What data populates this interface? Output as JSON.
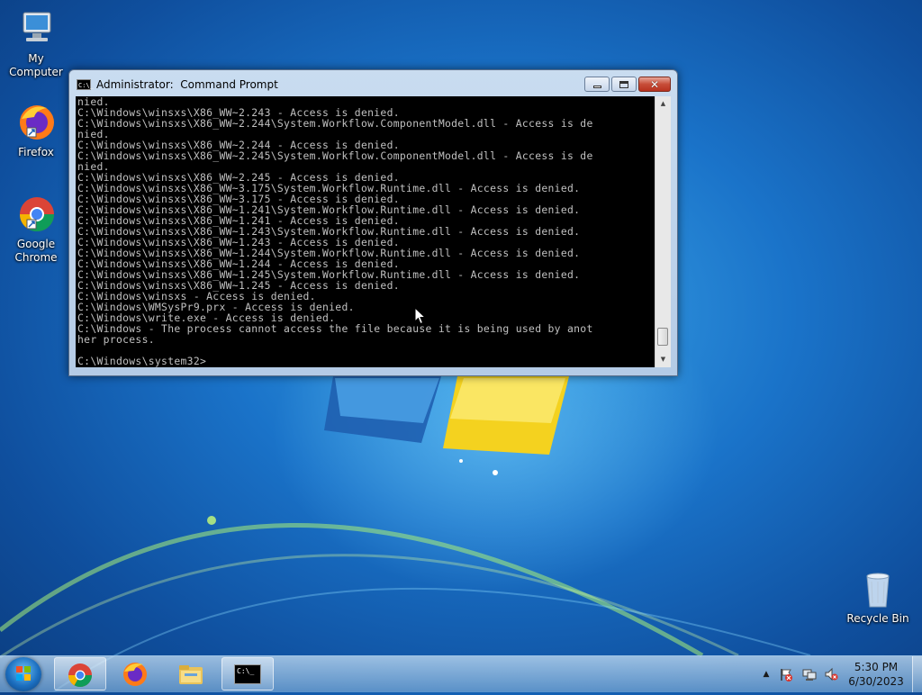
{
  "desktop": {
    "icons": [
      {
        "label": "My Computer"
      },
      {
        "label": "Firefox"
      },
      {
        "label": "Google\nChrome"
      },
      {
        "label": "Recycle Bin"
      }
    ]
  },
  "cmd_window": {
    "title": "Administrator:  Command Prompt",
    "icon_text": "C:\\_",
    "buttons": {
      "minimize": "minimize",
      "maximize": "maximize",
      "close": "✕"
    },
    "lines": [
      "nied.",
      "C:\\Windows\\winsxs\\X86_WW~2.243 - Access is denied.",
      "C:\\Windows\\winsxs\\X86_WW~2.244\\System.Workflow.ComponentModel.dll - Access is de",
      "nied.",
      "C:\\Windows\\winsxs\\X86_WW~2.244 - Access is denied.",
      "C:\\Windows\\winsxs\\X86_WW~2.245\\System.Workflow.ComponentModel.dll - Access is de",
      "nied.",
      "C:\\Windows\\winsxs\\X86_WW~2.245 - Access is denied.",
      "C:\\Windows\\winsxs\\X86_WW~3.175\\System.Workflow.Runtime.dll - Access is denied.",
      "C:\\Windows\\winsxs\\X86_WW~3.175 - Access is denied.",
      "C:\\Windows\\winsxs\\X86_WW~1.241\\System.Workflow.Runtime.dll - Access is denied.",
      "C:\\Windows\\winsxs\\X86_WW~1.241 - Access is denied.",
      "C:\\Windows\\winsxs\\X86_WW~1.243\\System.Workflow.Runtime.dll - Access is denied.",
      "C:\\Windows\\winsxs\\X86_WW~1.243 - Access is denied.",
      "C:\\Windows\\winsxs\\X86_WW~1.244\\System.Workflow.Runtime.dll - Access is denied.",
      "C:\\Windows\\winsxs\\X86_WW~1.244 - Access is denied.",
      "C:\\Windows\\winsxs\\X86_WW~1.245\\System.Workflow.Runtime.dll - Access is denied.",
      "C:\\Windows\\winsxs\\X86_WW~1.245 - Access is denied.",
      "C:\\Windows\\winsxs - Access is denied.",
      "C:\\Windows\\WMSysPr9.prx - Access is denied.",
      "C:\\Windows\\write.exe - Access is denied.",
      "C:\\Windows - The process cannot access the file because it is being used by anot",
      "her process.",
      "",
      "C:\\Windows\\system32>"
    ]
  },
  "taskbar": {
    "items": [
      {
        "name": "chrome",
        "active": true
      },
      {
        "name": "firefox",
        "active": false
      },
      {
        "name": "explorer",
        "active": false
      },
      {
        "name": "command-prompt",
        "active": true,
        "icon_text": "C:\\_"
      }
    ],
    "tray": {
      "show_hidden": "▲"
    },
    "clock": {
      "time": "5:30 PM",
      "date": "6/30/2023"
    }
  },
  "colors": {
    "console_bg": "#000000",
    "console_fg": "#c0c0c0",
    "desktop_bg": "#1a73c9"
  }
}
